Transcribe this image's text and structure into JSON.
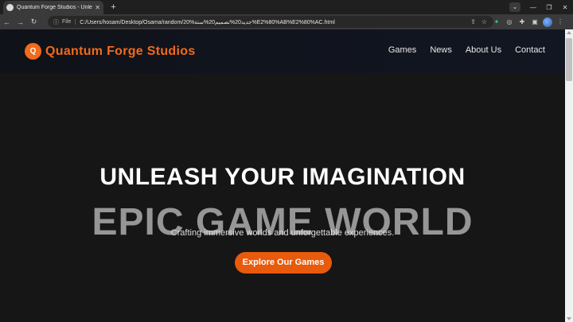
{
  "browser": {
    "tab_title": "Quantum Forge Studios - Unleash",
    "address_scheme": "File",
    "address_url": "C:/Users/hosam/Desktop/Osama/random/20%جديد20%تصميم20%ستة%E2%80%AB%E2%80%AC.html",
    "colors": {
      "chrome_dark": "#1f1f1f",
      "toolbar": "#3a3a3a"
    }
  },
  "site": {
    "brand_initial": "Q",
    "brand_name": "Quantum Forge Studios",
    "nav": [
      "Games",
      "News",
      "About Us",
      "Contact"
    ],
    "colors": {
      "accent": "#f26a1b",
      "background": "#161616"
    }
  },
  "hero": {
    "title": "UNLEASH YOUR IMAGINATION",
    "background_text": "EPIC GAME WORLD",
    "subtitle": "Crafting immersive worlds and unforgettable experiences.",
    "cta_label": "Explore Our Games"
  }
}
